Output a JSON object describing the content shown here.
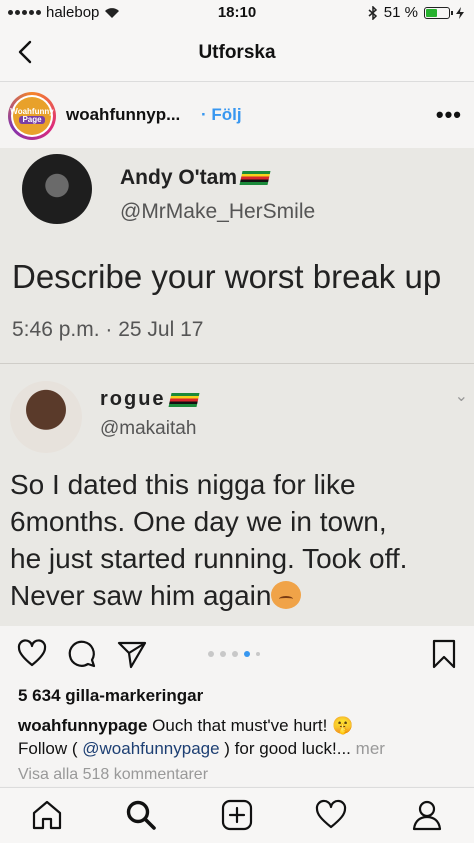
{
  "status_bar": {
    "carrier": "halebop",
    "time": "18:10",
    "battery": "51 %",
    "battery_level": 0.51
  },
  "header": {
    "title": "Utforska"
  },
  "post": {
    "username": "woahfunnyp...",
    "follow_label": "Följ",
    "avatar_text": [
      "Woahfunny",
      "Page"
    ],
    "image": {
      "tweet_name": "Andy O'tam",
      "tweet_handle": "@MrMake_HerSmile",
      "tweet_text": "Describe your worst break up",
      "tweet_date": "5:46 p.m. · 25 Jul 17",
      "reply_name": "rogue",
      "reply_handle": "@makaitah",
      "reply_text": "So I dated this nigga for like\n6months. One day we in town,\nhe just started running. Took off.\nNever saw him again"
    },
    "carousel": {
      "count": 5,
      "active_index": 3
    },
    "likes": "5 634 gilla-markeringar",
    "caption": {
      "username": "woahfunnypage",
      "text_line1": "Ouch that must've hurt!",
      "emoji": "🤫",
      "follow_prefix": "Follow (",
      "mention": "@woahfunnypage",
      "follow_suffix": ") for good luck!...",
      "more": "mer"
    },
    "comments_link": "Visa alla 518 kommentarer"
  },
  "icons": {
    "back": "chevron-left-icon",
    "like": "heart-icon",
    "comment": "comment-icon",
    "share": "send-icon",
    "save": "bookmark-icon",
    "nav": [
      "home-icon",
      "search-icon",
      "add-post-icon",
      "activity-icon",
      "profile-icon"
    ]
  },
  "colors": {
    "accent": "#3897f0",
    "battery": "#27b12e"
  }
}
